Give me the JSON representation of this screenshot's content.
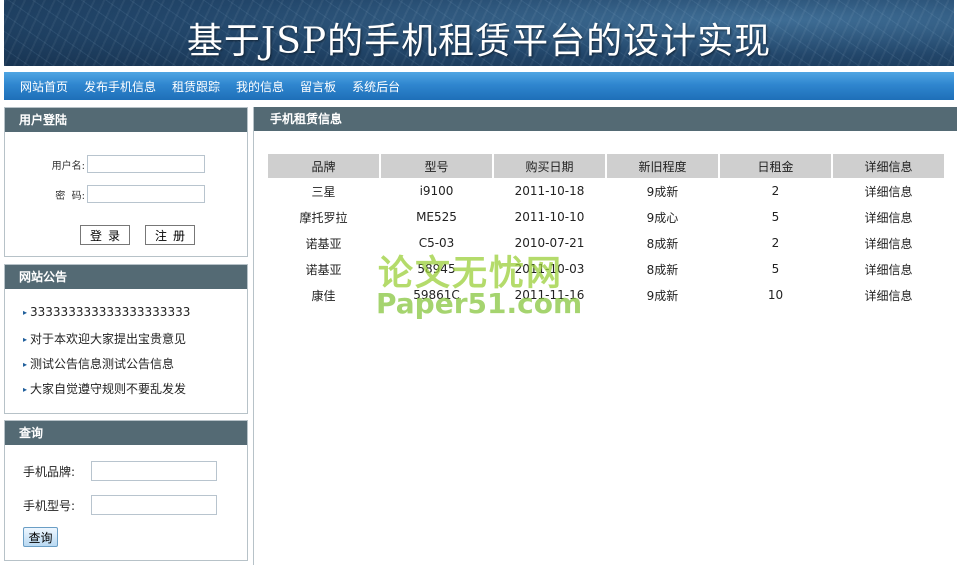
{
  "header": {
    "title": "基于JSP的手机租赁平台的设计实现"
  },
  "nav": {
    "items": [
      "网站首页",
      "发布手机信息",
      "租赁跟踪",
      "我的信息",
      "留言板",
      "系统后台"
    ]
  },
  "login": {
    "title": "用户登陆",
    "username_label": "用户名:",
    "password_label": "密  码:",
    "username_value": "",
    "password_value": "",
    "login_button": "登录",
    "register_button": "注册"
  },
  "notice": {
    "title": "网站公告",
    "items": [
      "333333333333333333333",
      "对于本欢迎大家提出宝贵意见",
      "测试公告信息测试公告信息",
      "大家自觉遵守规则不要乱发发"
    ]
  },
  "search": {
    "title": "查询",
    "brand_label": "手机品牌:",
    "model_label": "手机型号:",
    "brand_value": "",
    "model_value": "",
    "button": "查询"
  },
  "content": {
    "title": "手机租赁信息",
    "columns": [
      "品牌",
      "型号",
      "购买日期",
      "新旧程度",
      "日租金",
      "详细信息"
    ],
    "rows": [
      [
        "三星",
        "i9100",
        "2011-10-18",
        "9成新",
        "2",
        "详细信息"
      ],
      [
        "摩托罗拉",
        "ME525",
        "2011-10-10",
        "9成心",
        "5",
        "详细信息"
      ],
      [
        "诺基亚",
        "C5-03",
        "2010-07-21",
        "8成新",
        "2",
        "详细信息"
      ],
      [
        "诺基亚",
        "58945",
        "2011-10-03",
        "8成新",
        "5",
        "详细信息"
      ],
      [
        "康佳",
        "59861C",
        "2011-11-16",
        "9成新",
        "10",
        "详细信息"
      ]
    ]
  },
  "watermark": {
    "cn": "论文无忧网",
    "en": "Paper51.com"
  },
  "colors": {
    "nav": "#2f86cf",
    "panel_head": "#546a74",
    "header_cell": "#cfcfcf"
  }
}
